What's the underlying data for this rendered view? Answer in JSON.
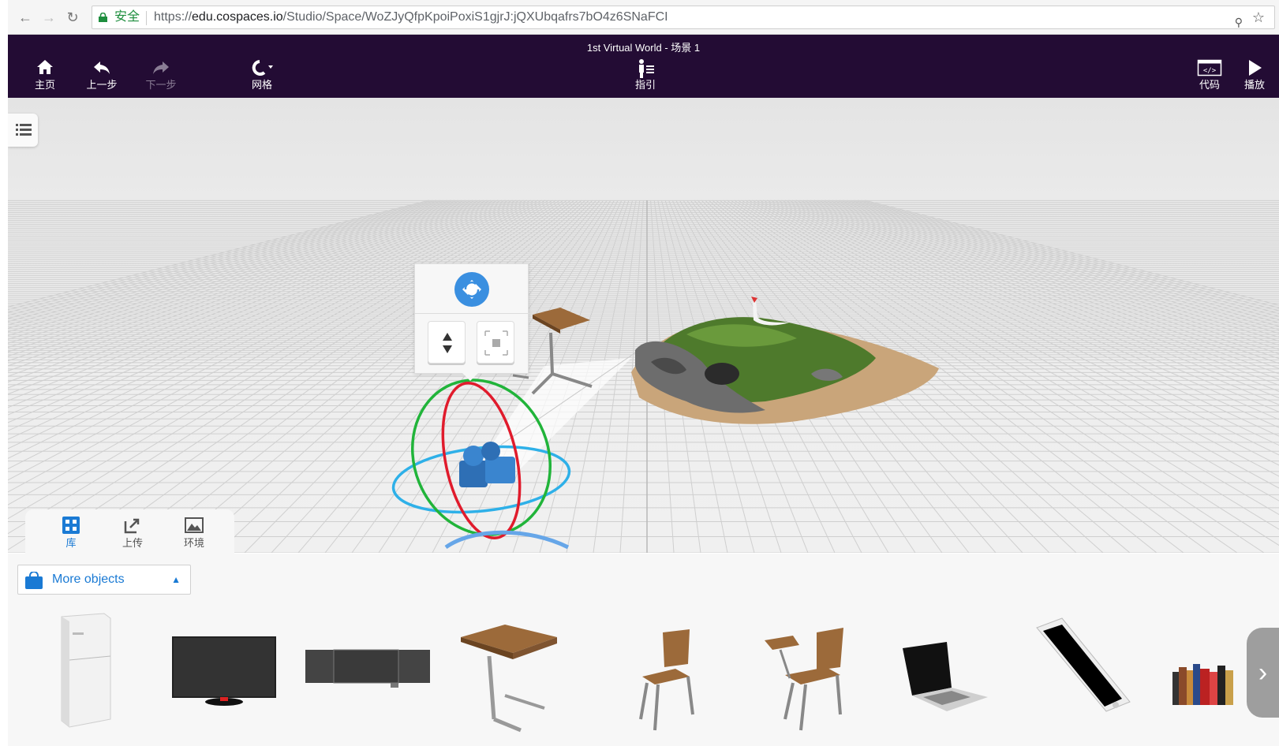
{
  "browser": {
    "secure_label": "安全",
    "url_prefix": "https://",
    "url_host": "edu.cospaces.io",
    "url_path": "/Studio/Space/WoZJyQfpKpoiPoxiS1gjrJ:jQXUbqafrs7bO4z6SNaFCI"
  },
  "toolbar": {
    "title": "1st Virtual World - 场景 1",
    "home_label": "主页",
    "undo_label": "上一步",
    "redo_label": "下一步",
    "grid_label": "网格",
    "guide_label": "指引",
    "code_label": "代码",
    "play_label": "播放"
  },
  "library": {
    "tabs": [
      {
        "label": "库",
        "icon": "library-icon",
        "active": true
      },
      {
        "label": "上传",
        "icon": "upload-icon",
        "active": false
      },
      {
        "label": "环境",
        "icon": "environment-icon",
        "active": false
      }
    ],
    "category_label": "More objects",
    "items": [
      {
        "name": "fridge"
      },
      {
        "name": "tv"
      },
      {
        "name": "whiteboard"
      },
      {
        "name": "school-desk"
      },
      {
        "name": "chair"
      },
      {
        "name": "student-chair"
      },
      {
        "name": "laptop"
      },
      {
        "name": "smartphone"
      },
      {
        "name": "books"
      }
    ]
  },
  "colors": {
    "toolbar_bg": "#230c34",
    "accent": "#1a7ad4",
    "secure_green": "#1e8e3e"
  }
}
